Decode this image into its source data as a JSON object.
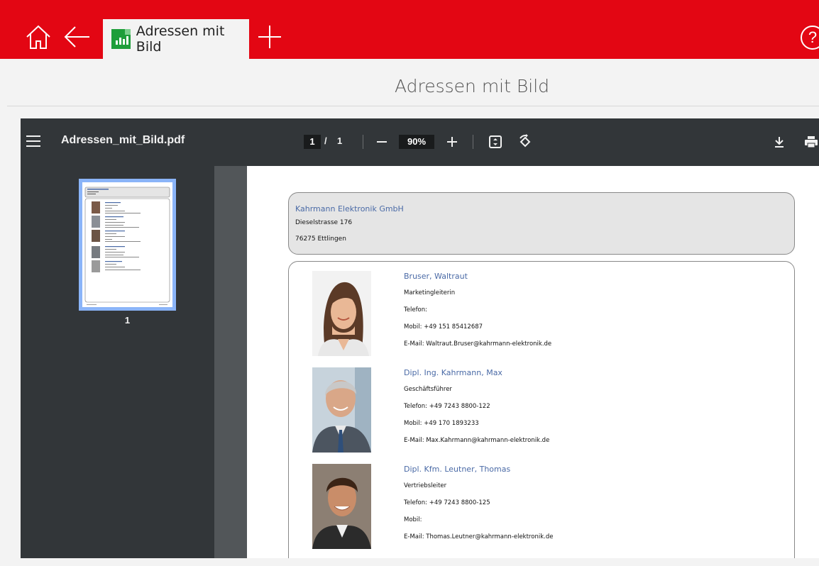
{
  "app": {
    "tab_title": "Adressen mit Bild",
    "page_title": "Adressen mit Bild",
    "help_label": "?",
    "brand_color": "#e30613"
  },
  "viewer": {
    "file_name": "Adressen_mit_Bild.pdf",
    "current_page": "1",
    "page_separator": "/",
    "total_pages": "1",
    "zoom": "90%",
    "thumbnail_label": "1"
  },
  "document": {
    "company": {
      "name": "Kahrmann Elektronik GmbH",
      "street": "Dieselstrasse 176",
      "city": "76275 Ettlingen"
    },
    "contacts": [
      {
        "name": "Bruser, Waltraut",
        "role": "Marketingleiterin",
        "phone": "Telefon:",
        "mobile": "Mobil: +49 151 85412687",
        "email": "E-Mail: Waltraut.Bruser@kahrmann-elektronik.de"
      },
      {
        "name": "Dipl. Ing. Kahrmann, Max",
        "role": "Geschäftsführer",
        "phone": "Telefon: +49 7243 8800-122",
        "mobile": "Mobil: +49 170 1893233",
        "email": "E-Mail: Max.Kahrmann@kahrmann-elektronik.de"
      },
      {
        "name": "Dipl. Kfm. Leutner, Thomas",
        "role": "Vertriebsleiter",
        "phone": "Telefon: +49 7243 8800-125",
        "mobile": "Mobil:",
        "email": "E-Mail: Thomas.Leutner@kahrmann-elektronik.de"
      }
    ]
  }
}
